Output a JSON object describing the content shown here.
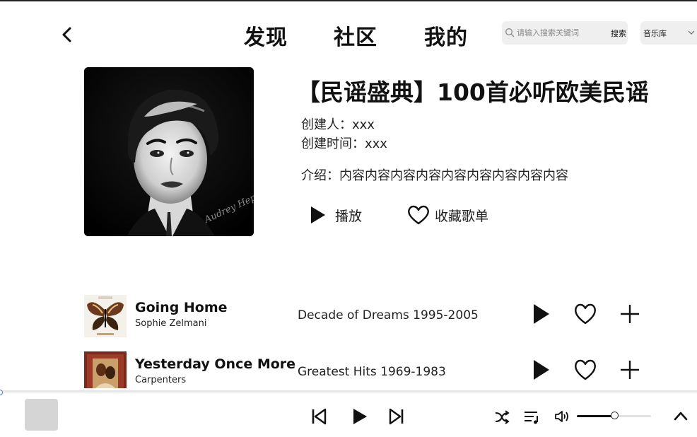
{
  "nav": {
    "tabs": [
      {
        "label": "发现"
      },
      {
        "label": "社区"
      },
      {
        "label": "我的"
      }
    ],
    "search": {
      "placeholder": "请输入搜索关键词",
      "button_label": "搜索"
    },
    "library_select": {
      "value": "音乐库"
    }
  },
  "playlist": {
    "title": "【民谣盛典】100首必听欧美民谣",
    "creator": "创建人：xxx",
    "created_time": "创建时间：xxx",
    "intro": "介绍：内容内容内容内容内容内容内容内容内容",
    "play_label": "播放",
    "favorite_label": "收藏歌单",
    "cover_signature": "Audrey Hepburn"
  },
  "songs": [
    {
      "title": "Going Home",
      "artist": "Sophie Zelmani",
      "album": "Decade of Dreams 1995-2005"
    },
    {
      "title": "Yesterday Once More",
      "artist": "Carpenters",
      "album": "Greatest Hits 1969-1983"
    }
  ],
  "player": {
    "progress": 0.0,
    "volume": 0.5
  },
  "icons": {
    "back": "chevron-left-icon",
    "search": "search-icon",
    "dropdown": "chevron-down-icon",
    "play": "play-icon",
    "heart": "heart-icon",
    "add": "plus-icon",
    "prev": "skip-previous-icon",
    "next": "skip-next-icon",
    "shuffle": "shuffle-icon",
    "queue": "playlist-icon",
    "volume": "volume-icon",
    "expand": "chevron-up-icon"
  },
  "colors": {
    "accent_knob": "#3a7bd5",
    "search_bg": "#efefef",
    "text": "#111111"
  }
}
